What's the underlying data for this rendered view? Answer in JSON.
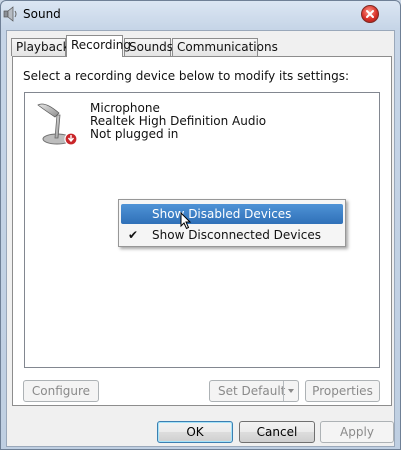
{
  "window": {
    "title": "Sound",
    "icons": {
      "app": "speaker-icon",
      "close": "close-icon"
    }
  },
  "tabs": [
    {
      "label": "Playback"
    },
    {
      "label": "Recording"
    },
    {
      "label": "Sounds"
    },
    {
      "label": "Communications"
    }
  ],
  "active_tab": "Recording",
  "recording": {
    "instruction": "Select a recording device below to modify its settings:",
    "devices": [
      {
        "name": "Microphone",
        "driver": "Realtek High Definition Audio",
        "status": "Not plugged in",
        "icon": "microphone-icon"
      }
    ]
  },
  "context_menu": {
    "items": [
      {
        "label": "Show Disabled Devices",
        "checked": false,
        "highlighted": true
      },
      {
        "label": "Show Disconnected Devices",
        "checked": true,
        "highlighted": false
      }
    ]
  },
  "panel_buttons": {
    "configure": "Configure",
    "set_default": "Set Default",
    "properties": "Properties"
  },
  "dialog_buttons": {
    "ok": "OK",
    "cancel": "Cancel",
    "apply": "Apply"
  },
  "colors": {
    "highlight": "#3a7bc8",
    "close_button": "#d8322a"
  }
}
